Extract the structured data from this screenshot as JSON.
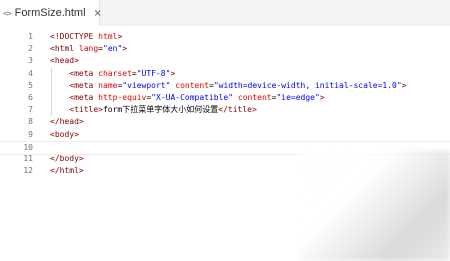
{
  "tab": {
    "icon": "<>",
    "filename": "FormSize.html",
    "close": "×"
  },
  "lines": [
    {
      "n": "1",
      "tokens": [
        {
          "c": "tag",
          "t": "<!DOCTYPE "
        },
        {
          "c": "attr",
          "t": "html"
        },
        {
          "c": "tag",
          "t": ">"
        }
      ]
    },
    {
      "n": "2",
      "tokens": [
        {
          "c": "tag",
          "t": "<html "
        },
        {
          "c": "attr",
          "t": "lang"
        },
        {
          "c": "plain",
          "t": "="
        },
        {
          "c": "val",
          "t": "\"en\""
        },
        {
          "c": "tag",
          "t": ">"
        }
      ]
    },
    {
      "n": "3",
      "tokens": [
        {
          "c": "tag",
          "t": "<head>"
        }
      ]
    },
    {
      "n": "4",
      "tokens": [
        {
          "c": "plain",
          "t": "    "
        },
        {
          "c": "tag",
          "t": "<meta "
        },
        {
          "c": "attr",
          "t": "charset"
        },
        {
          "c": "plain",
          "t": "="
        },
        {
          "c": "val",
          "t": "\"UTF-8\""
        },
        {
          "c": "tag",
          "t": ">"
        }
      ]
    },
    {
      "n": "5",
      "tokens": [
        {
          "c": "plain",
          "t": "    "
        },
        {
          "c": "tag",
          "t": "<meta "
        },
        {
          "c": "attr",
          "t": "name"
        },
        {
          "c": "plain",
          "t": "="
        },
        {
          "c": "val",
          "t": "\"viewport\""
        },
        {
          "c": "plain",
          "t": " "
        },
        {
          "c": "attr",
          "t": "content"
        },
        {
          "c": "plain",
          "t": "="
        },
        {
          "c": "val",
          "t": "\"width=device-width, initial-scale=1.0\""
        },
        {
          "c": "tag",
          "t": ">"
        }
      ]
    },
    {
      "n": "6",
      "tokens": [
        {
          "c": "plain",
          "t": "    "
        },
        {
          "c": "tag",
          "t": "<meta "
        },
        {
          "c": "attr",
          "t": "http-equiv"
        },
        {
          "c": "plain",
          "t": "="
        },
        {
          "c": "val",
          "t": "\"X-UA-Compatible\""
        },
        {
          "c": "plain",
          "t": " "
        },
        {
          "c": "attr",
          "t": "content"
        },
        {
          "c": "plain",
          "t": "="
        },
        {
          "c": "val",
          "t": "\"ie=edge\""
        },
        {
          "c": "tag",
          "t": ">"
        }
      ]
    },
    {
      "n": "7",
      "tokens": [
        {
          "c": "plain",
          "t": "    "
        },
        {
          "c": "tag",
          "t": "<title>"
        },
        {
          "c": "plain",
          "t": "form下拉菜单字体大小如何设置"
        },
        {
          "c": "tag",
          "t": "</title>"
        }
      ]
    },
    {
      "n": "8",
      "tokens": [
        {
          "c": "tag",
          "t": "</head>"
        }
      ]
    },
    {
      "n": "9",
      "tokens": [
        {
          "c": "tag",
          "t": "<body>"
        }
      ]
    },
    {
      "n": "10",
      "tokens": [],
      "current": true
    },
    {
      "n": "11",
      "tokens": [
        {
          "c": "tag",
          "t": "</body>"
        }
      ]
    },
    {
      "n": "12",
      "tokens": [
        {
          "c": "tag",
          "t": "</html>"
        }
      ]
    }
  ]
}
